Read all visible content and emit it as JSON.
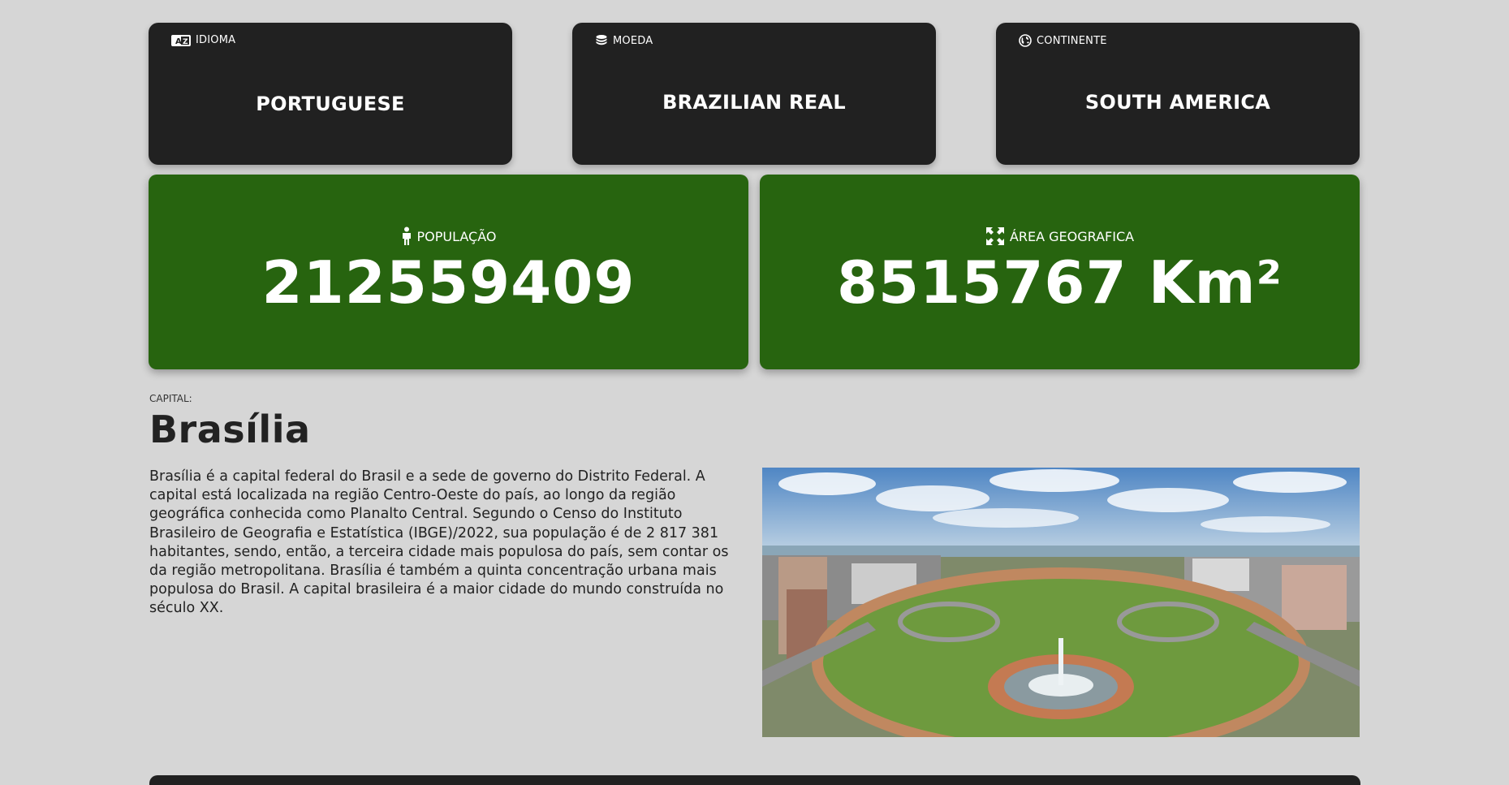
{
  "cards": {
    "language": {
      "label": "IDIOMA",
      "value": "PORTUGUESE",
      "icon": "language-icon"
    },
    "currency": {
      "label": "MOEDA",
      "value": "BRAZILIAN REAL",
      "icon": "coins-icon"
    },
    "continent": {
      "label": "CONTINENTE",
      "value": "SOUTH AMERICA",
      "icon": "globe-icon"
    }
  },
  "stats": {
    "population": {
      "label": "POPULAÇÃO",
      "value": "212559409",
      "icon": "person-icon"
    },
    "area": {
      "label": "ÁREA GEOGRAFICA",
      "value": "8515767 Km²",
      "icon": "expand-arrows-icon"
    }
  },
  "capital": {
    "caption": "CAPITAL:",
    "name": "Brasília",
    "description": "Brasília é a capital federal do Brasil e a sede de governo do Distrito Federal. A capital está localizada na região Centro-Oeste do país, ao longo da região geográfica conhecida como Planalto Central. Segundo o Censo do Instituto Brasileiro de Geografia e Estatística (IBGE)/2022, sua população é de 2 817 381 habitantes, sendo, então, a terceira cidade mais populosa do país, sem contar os da região metropolitana. Brasília é também a quinta concentração urbana mais populosa do Brasil. A capital brasileira é a maior cidade do mundo construída no século XX."
  },
  "colors": {
    "background": "#d6d6d6",
    "dark_card": "#212121",
    "green_card": "#27640f",
    "text_light": "#ffffff",
    "text_dark": "#222222"
  }
}
